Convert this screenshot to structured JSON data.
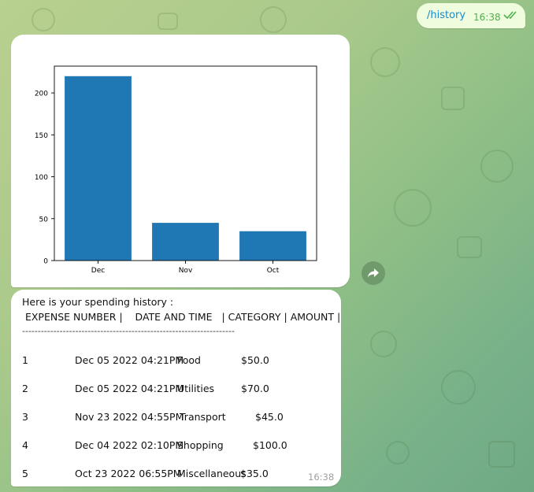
{
  "outgoing": {
    "text": "/history",
    "time": "16:38",
    "status": "read"
  },
  "chart_data": {
    "type": "bar",
    "categories": [
      "Dec",
      "Nov",
      "Oct"
    ],
    "values": [
      220,
      45,
      35
    ],
    "ylim": [
      0,
      232
    ],
    "yticks": [
      "0",
      "50",
      "100",
      "150",
      "200"
    ],
    "bar_color": "#1f77b4",
    "grid": false
  },
  "history": {
    "intro": "Here is your spending history :",
    "header": " EXPENSE NUMBER |    DATE AND TIME   | CATEGORY | AMOUNT |",
    "divider": "--------------------------------------------------------------------",
    "rows": [
      {
        "num": "1",
        "date": "Dec 05 2022 04:21PM",
        "category": "Food",
        "amount": "$50.0"
      },
      {
        "num": "2",
        "date": "Dec 05 2022 04:21PM",
        "category": "Utilities",
        "amount": "$70.0"
      },
      {
        "num": "3",
        "date": "Nov 23 2022 04:55PM",
        "category": "Transport",
        "amount": "$45.0"
      },
      {
        "num": "4",
        "date": "Dec 04 2022 02:10PM",
        "category": "Shopping",
        "amount": "$100.0"
      },
      {
        "num": "5",
        "date": "Oct 23 2022 06:55PM",
        "category": "Miscellaneous",
        "amount": "$35.0"
      }
    ],
    "time": "16:38"
  },
  "colors": {
    "outgoing_bubble": "#effdde",
    "link": "#168acd",
    "read_check": "#4fae4e"
  },
  "icons": {
    "share": "share-arrow-icon",
    "read": "double-check-icon"
  }
}
